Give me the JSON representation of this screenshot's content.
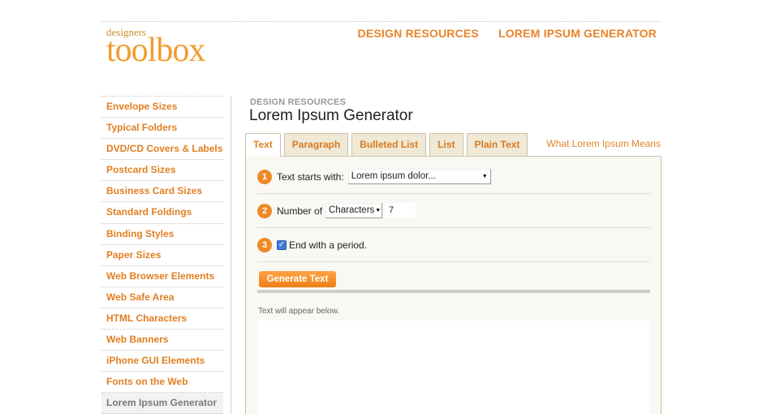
{
  "logo": {
    "small": "designers",
    "big": "toolbox"
  },
  "topnav": [
    "DESIGN RESOURCES",
    "LOREM IPSUM GENERATOR"
  ],
  "sidebar": [
    {
      "label": "Envelope Sizes"
    },
    {
      "label": "Typical Folders"
    },
    {
      "label": "DVD/CD Covers & Labels"
    },
    {
      "label": "Postcard Sizes"
    },
    {
      "label": "Business Card Sizes"
    },
    {
      "label": "Standard Foldings"
    },
    {
      "label": "Binding Styles"
    },
    {
      "label": "Paper Sizes"
    },
    {
      "label": "Web Browser Elements"
    },
    {
      "label": "Web Safe Area"
    },
    {
      "label": "HTML Characters"
    },
    {
      "label": "Web Banners"
    },
    {
      "label": "iPhone GUI Elements"
    },
    {
      "label": "Fonts on the Web"
    },
    {
      "label": "Lorem Ipsum Generator",
      "active": true
    }
  ],
  "main": {
    "eyebrow": "DESIGN RESOURCES",
    "title": "Lorem Ipsum Generator",
    "tabs": [
      "Text",
      "Paragraph",
      "Bulleted List",
      "List",
      "Plain Text"
    ],
    "active_tab": "Text",
    "what_link": "What Lorem Ipsum Means"
  },
  "form": {
    "step1": {
      "num": "1",
      "label": "Text starts with:",
      "value": "Lorem ipsum dolor..."
    },
    "step2": {
      "num": "2",
      "label": "Number of",
      "unit": "Characters",
      "count": "7"
    },
    "step3": {
      "num": "3",
      "label": "End with a period.",
      "checked": true
    },
    "button": "Generate Text",
    "hint": "Text will appear below.",
    "output": ""
  },
  "colors": {
    "accent": "#e8842a",
    "panel_bg": "#f9f8f2",
    "tab_bg": "#efe9d6"
  }
}
